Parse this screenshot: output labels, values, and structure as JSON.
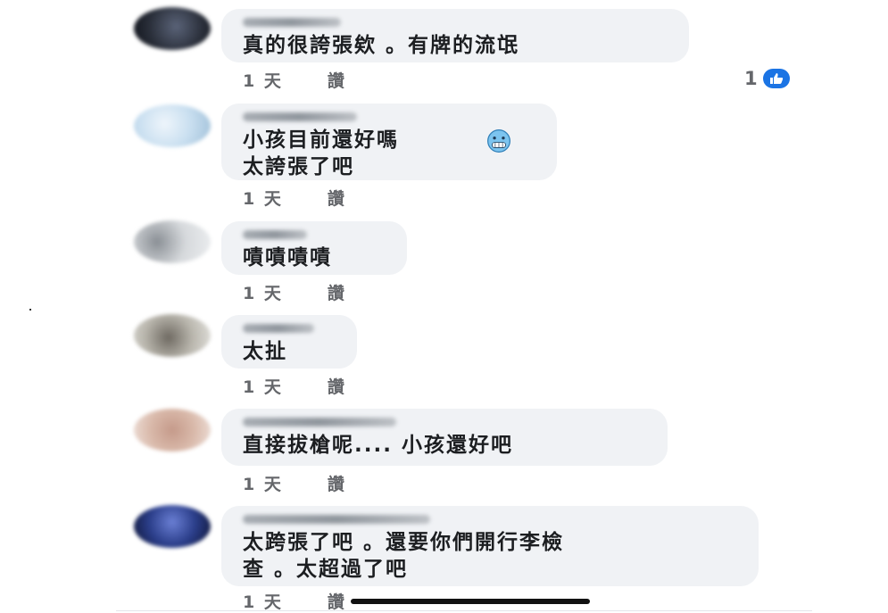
{
  "comments": [
    {
      "text": "真的很誇張欸 。有牌的流氓",
      "time": "1 天",
      "like_label": "讚",
      "avatar_color": "#2a2f3a"
    },
    {
      "text": "小孩目前還好嗎\n太誇張了吧",
      "time": "1 天",
      "like_label": "讚",
      "avatar_color": "#c9dff0",
      "emoji": "cold-face-emoji"
    },
    {
      "text": "嘖嘖嘖嘖",
      "time": "1 天",
      "like_label": "讚",
      "avatar_color": "#d6d9dc"
    },
    {
      "text": "太扯",
      "time": "1 天",
      "like_label": "讚",
      "avatar_color": "#b9b6ad"
    },
    {
      "text": "直接拔槍呢.... 小孩還好吧",
      "time": "1 天",
      "like_label": "讚",
      "avatar_color": "#d9b9aa"
    },
    {
      "text": "太跨張了吧 。還要你們開行李檢\n查 。太超過了吧",
      "time": "1 天",
      "like_label": "讚",
      "avatar_color": "#2b3e8a"
    }
  ],
  "reaction": {
    "count": "1",
    "icon": "thumbs-up-icon",
    "color": "#1b74e4"
  }
}
